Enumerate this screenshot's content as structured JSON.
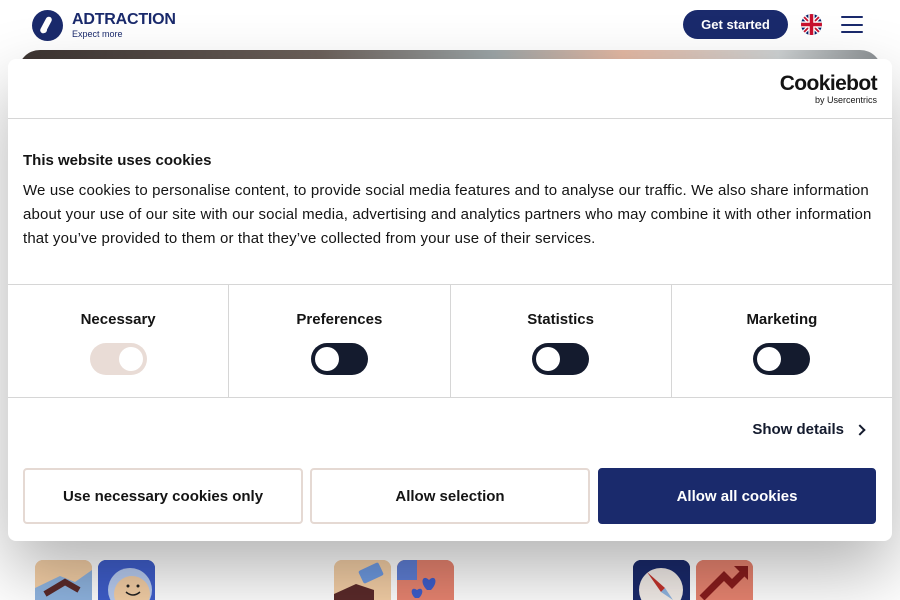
{
  "site": {
    "logo_name": "ADTRACTION",
    "logo_tagline": "Expect more",
    "get_started_label": "Get started",
    "language_flag": "uk-flag-icon",
    "menu_icon": "hamburger-menu-icon",
    "brand_color": "#1a2a6c"
  },
  "cookie_dialog": {
    "brand_word": "Cookiebot",
    "brand_sub": "by Usercentrics",
    "title": "This website uses cookies",
    "body": "We use cookies to personalise content, to provide social media features and to analyse our traffic. We also share information about your use of our site with our social media, advertising and analytics partners who may combine it with other information that you’ve provided to them or that they’ve collected from your use of their services.",
    "toggles": [
      {
        "label": "Necessary",
        "enabled": true,
        "locked": true
      },
      {
        "label": "Preferences",
        "enabled": false
      },
      {
        "label": "Statistics",
        "enabled": false
      },
      {
        "label": "Marketing",
        "enabled": false
      }
    ],
    "show_details_label": "Show details",
    "buttons": {
      "necessary_only": "Use necessary cookies only",
      "allow_selection": "Allow selection",
      "allow_all": "Allow all cookies"
    }
  },
  "feature_icons": [
    "handshake-icon",
    "smiley-moon-icon",
    "payment-hand-icon",
    "hearts-icon",
    "compass-icon",
    "growth-arrow-icon"
  ]
}
